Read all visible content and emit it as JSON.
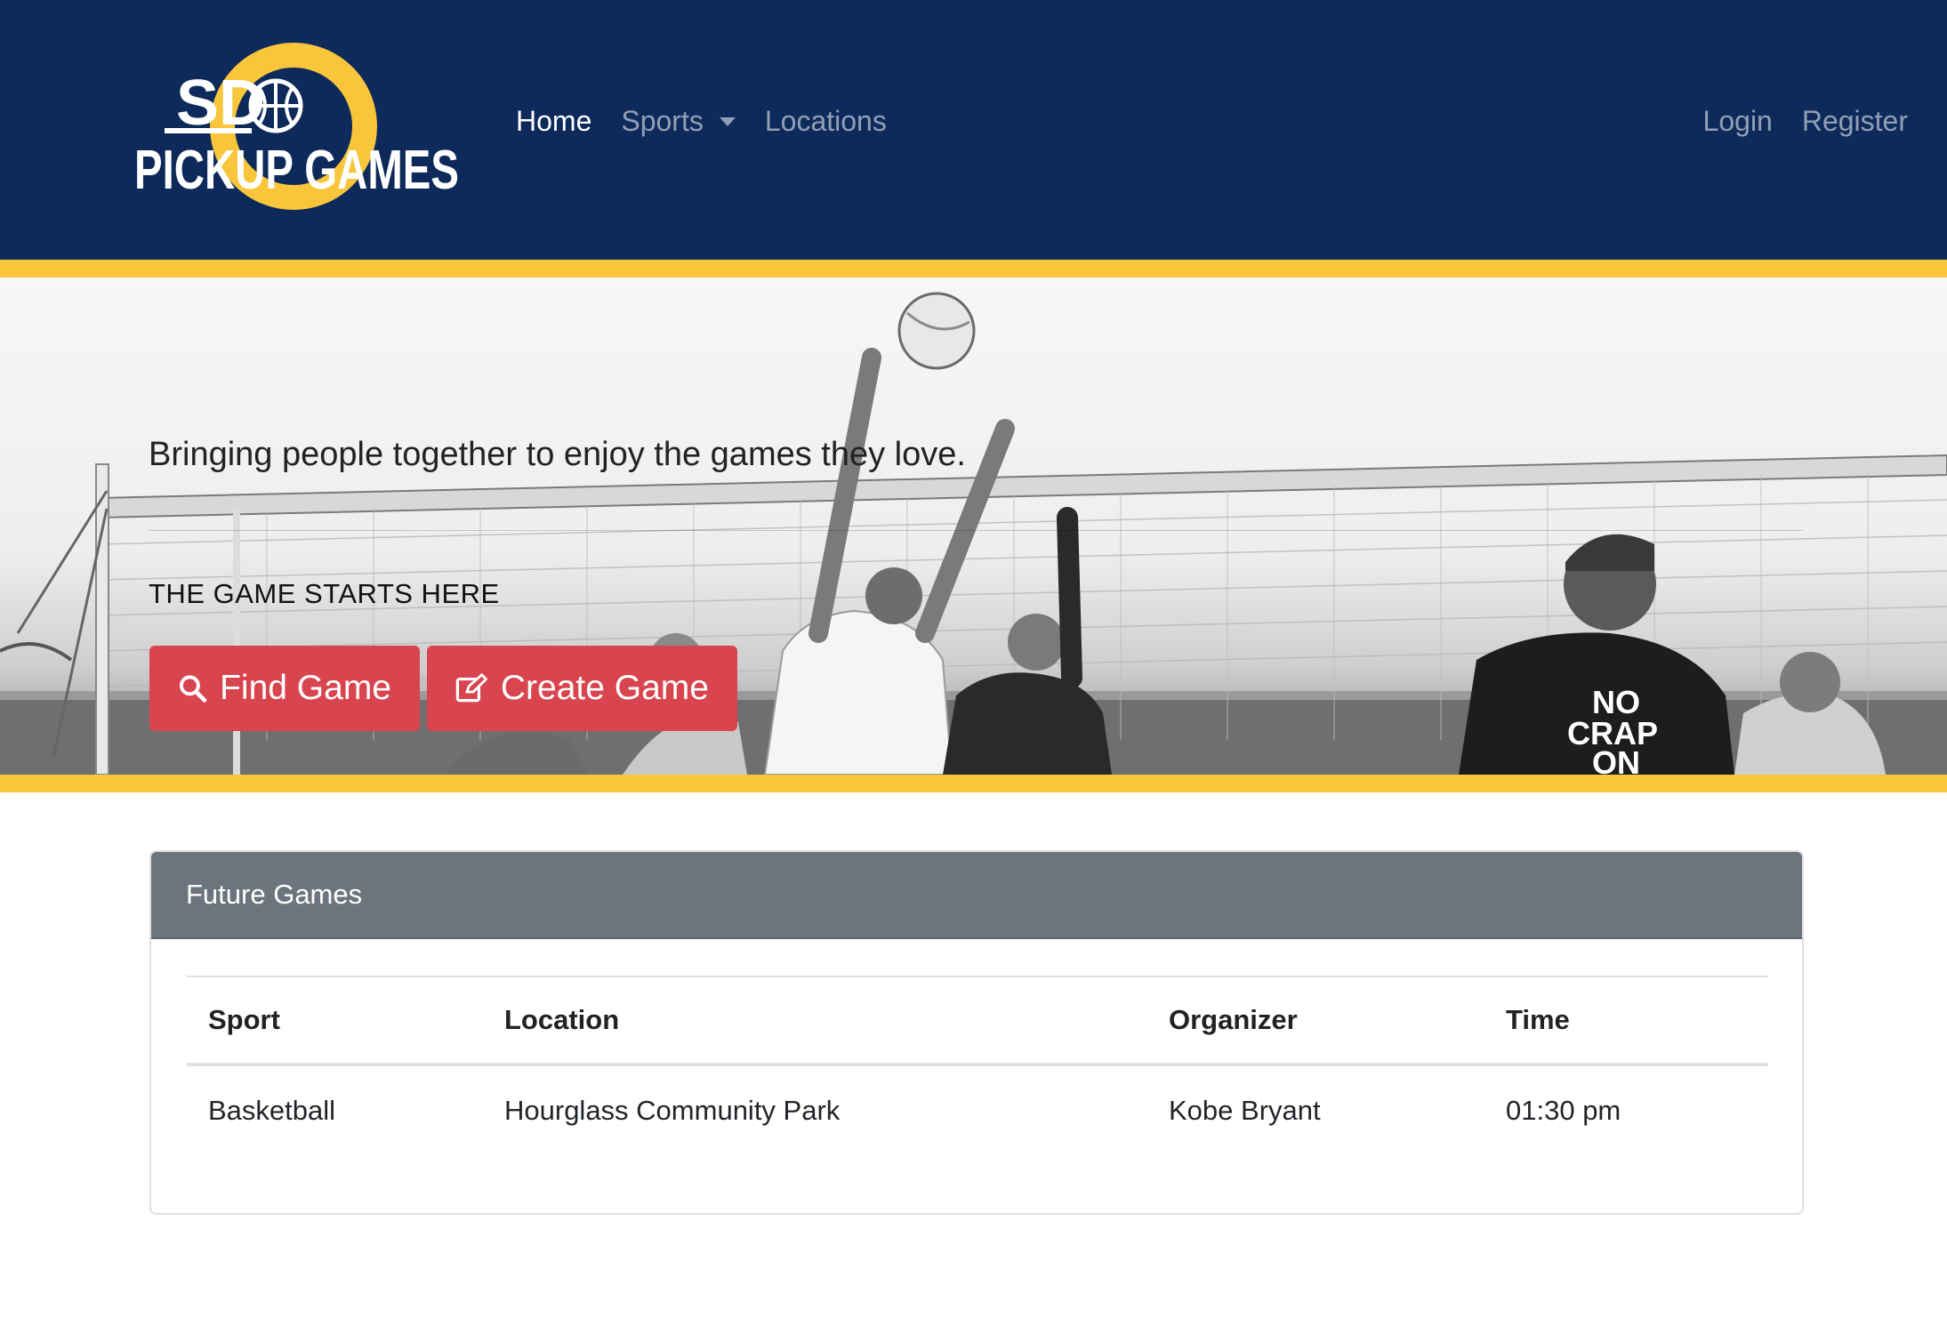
{
  "navbar": {
    "logo": {
      "line1": "SD",
      "line2": "PICKUP GAMES"
    },
    "links": [
      {
        "label": "Home",
        "active": true
      },
      {
        "label": "Sports",
        "dropdown": true
      },
      {
        "label": "Locations"
      }
    ],
    "right_links": [
      {
        "label": "Login"
      },
      {
        "label": "Register"
      }
    ]
  },
  "hero": {
    "tagline": "Bringing people together to enjoy the games they love.",
    "lead": "THE GAME STARTS HERE",
    "buttons": {
      "find_label": "Find Game",
      "create_label": "Create Game"
    },
    "shirt_text": [
      "NO",
      "CRAP",
      "ON"
    ]
  },
  "future_games": {
    "title": "Future Games",
    "columns": [
      "Sport",
      "Location",
      "Organizer",
      "Time"
    ],
    "rows": [
      [
        "Basketball",
        "Hourglass Community Park",
        "Kobe Bryant",
        "01:30 pm"
      ]
    ]
  },
  "colors": {
    "navbar_bg": "#0d2a5b",
    "accent_yellow": "#f8c53b",
    "button_red": "#d9454f",
    "card_header": "#6c757d"
  },
  "icons": [
    "basketball-icon",
    "search-icon",
    "edit-icon",
    "chevron-down-icon"
  ]
}
